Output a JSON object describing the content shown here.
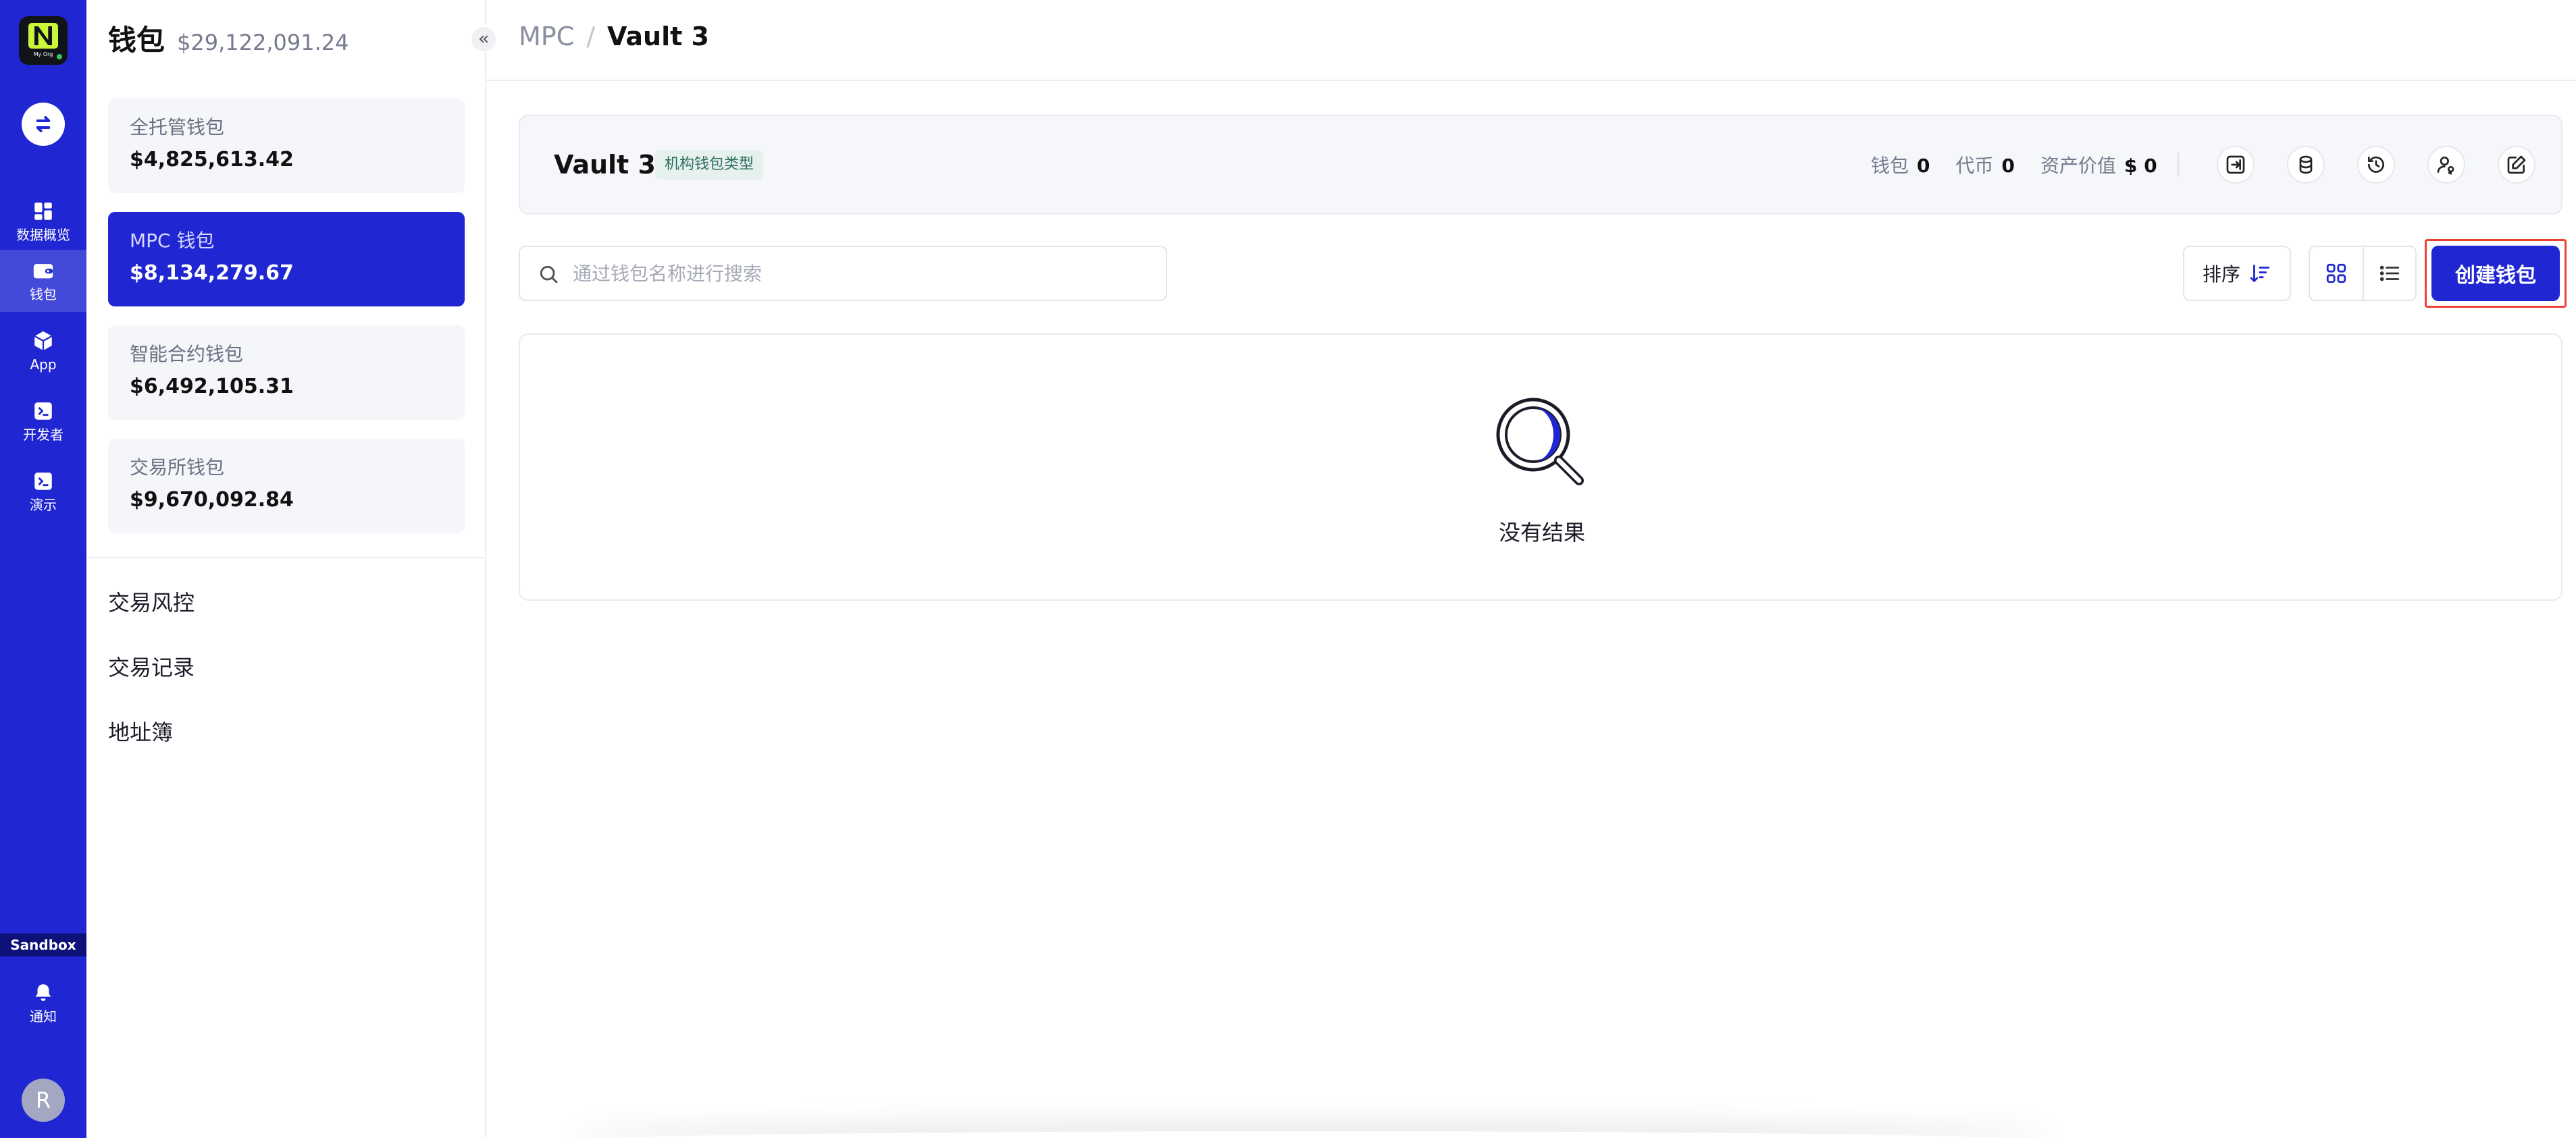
{
  "org": {
    "name": "My Org"
  },
  "rail": {
    "items": [
      {
        "label": "数据概览",
        "icon": "dashboard-icon"
      },
      {
        "label": "钱包",
        "icon": "wallet-icon"
      },
      {
        "label": "App",
        "icon": "cube-icon"
      },
      {
        "label": "开发者",
        "icon": "terminal-icon"
      },
      {
        "label": "演示",
        "icon": "terminal-icon"
      }
    ],
    "active": "钱包",
    "sandbox": "Sandbox",
    "notifications": {
      "label": "通知",
      "icon": "bell-icon"
    },
    "avatar": "R"
  },
  "panel": {
    "title": "钱包",
    "total": "$29,122,091.24",
    "wallets": [
      {
        "name": "全托管钱包",
        "amount": "$4,825,613.42"
      },
      {
        "name": "MPC 钱包",
        "amount": "$8,134,279.67"
      },
      {
        "name": "智能合约钱包",
        "amount": "$6,492,105.31"
      },
      {
        "name": "交易所钱包",
        "amount": "$9,670,092.84"
      }
    ],
    "active_wallet": "MPC 钱包",
    "links": [
      "交易风控",
      "交易记录",
      "地址簿"
    ]
  },
  "breadcrumb": {
    "root": "MPC",
    "separator": "/",
    "current": "Vault 3"
  },
  "vault": {
    "name": "Vault 3",
    "tag": "机构钱包类型",
    "stats": [
      {
        "label": "钱包",
        "value": "0"
      },
      {
        "label": "代币",
        "value": "0"
      },
      {
        "label": "资产价值",
        "value": "$ 0"
      }
    ],
    "actions": [
      "login-icon",
      "coins-icon",
      "history-icon",
      "user-key-icon",
      "edit-icon"
    ]
  },
  "toolbar": {
    "search_placeholder": "通过钱包名称进行搜索",
    "search_value": "",
    "sort_label": "排序",
    "create_label": "创建钱包"
  },
  "results": {
    "empty_text": "没有结果"
  },
  "colors": {
    "brand": "#2027d2",
    "highlight": "#ea4438",
    "tag_bg": "#e6f1ee",
    "tag_text": "#2d6e5f"
  }
}
